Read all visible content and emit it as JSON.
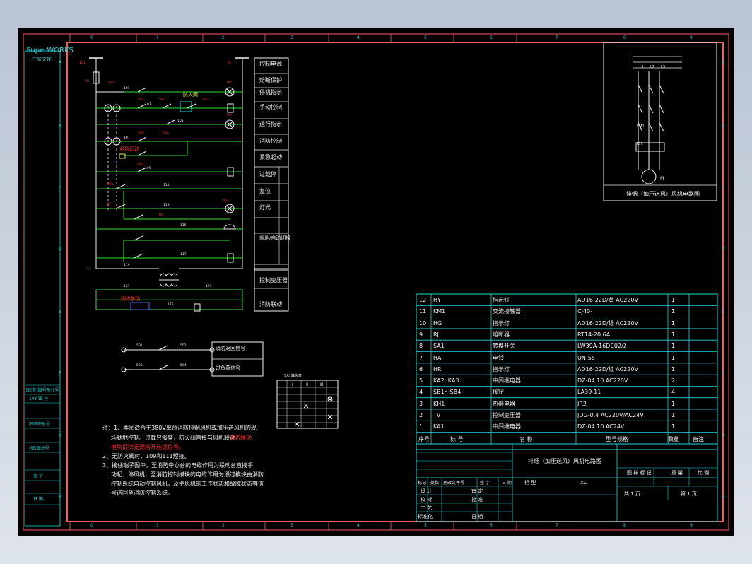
{
  "logo": {
    "brand": "SuperWORKS",
    "sub": "注册文件"
  },
  "ruler": {
    "top": [
      "0",
      "1",
      "2",
      "3",
      "4",
      "5",
      "6",
      "7",
      "8",
      "9"
    ],
    "left": [
      "A",
      "B",
      "C",
      "D",
      "E",
      "F",
      "G",
      "H"
    ]
  },
  "left_strip": [
    "图(参)图号及代号",
    "10Y 图 号",
    "旧底图总号",
    "(底)图总号",
    "签 字",
    "日 期"
  ],
  "schematic": {
    "panel_labels": [
      "控制电源",
      "熔断保护",
      "停机指示",
      "手动控制",
      "运行指示",
      "消防控制",
      "紧急起动",
      "过载停",
      "复位",
      "灯光",
      "就地/自动切换",
      "控制变压器",
      "消防联动"
    ],
    "fire_valve": "防火阀",
    "emergency_start": "紧急起动",
    "link_label": "消防联动",
    "top_node_left": "1L1",
    "top_node_right": "N",
    "wire_numbers": [
      "101",
      "103",
      "105",
      "107",
      "109",
      "111",
      "113",
      "115",
      "117",
      "119",
      "121",
      "173",
      "175",
      "177"
    ],
    "component_tags": [
      "FU",
      "SA1",
      "HR",
      "KA2",
      "HG",
      "SB1",
      "SB2",
      "SB3",
      "SB4",
      "KA1",
      "KH1",
      "TV",
      "HY",
      "KA3"
    ],
    "signal_labels": [
      "消防返回信号",
      "过负荷信号"
    ],
    "signal_wires": [
      "501",
      "502",
      "503",
      "504"
    ]
  },
  "motor_diagram": {
    "caption": "排烟（加压送风）风机电路图",
    "phases": [
      "L1",
      "L2",
      "L3"
    ],
    "km": "KM1",
    "kh": "KH",
    "motor": "M"
  },
  "switch_table": {
    "title": "SA1触头表",
    "headers": [
      "Ⅰ",
      "Ⅱ",
      "Ⅲ"
    ]
  },
  "notes": {
    "line1a": "注：1、本图适合于380V单台消防排烟风机或加压送风机的现",
    "line1b": "场就地控制。过载只报警，防火阀直接与风机联动，",
    "line1c_red": "消防联动",
    "line1d": "模块提供无源常开连锁信号。",
    "line2": "2、无防火阀时，109和111短接。",
    "line3a": "3、接线端子图中，至消防中心台的电缆作用为联动台直接手",
    "line3b": "动起、停风机，至消防控制模块的电缆作用为通过模块由消防",
    "line3c": "控制系统自动控制风机，及把风机的工作状态和故障状态等信",
    "line3d": "号送回至消防控制系统。"
  },
  "bom": {
    "rows": [
      {
        "no": "12",
        "code": "HY",
        "name": "指示灯",
        "spec": "AD16-22D/黄 AC220V",
        "qty": "1",
        "note": ""
      },
      {
        "no": "11",
        "code": "KM1",
        "name": "交流接触器",
        "spec": "CJ40-",
        "qty": "1",
        "note": ""
      },
      {
        "no": "10",
        "code": "HG",
        "name": "指示灯",
        "spec": "AD16-22D/绿 AC220V",
        "qty": "1",
        "note": ""
      },
      {
        "no": "9",
        "code": "RJ",
        "name": "熔断器",
        "spec": "RT14-20 6A",
        "qty": "1",
        "note": ""
      },
      {
        "no": "8",
        "code": "SA1",
        "name": "转换开关",
        "spec": "LW39A-16DC02/2",
        "qty": "1",
        "note": ""
      },
      {
        "no": "7",
        "code": "HA",
        "name": "电铃",
        "spec": "UN-55",
        "qty": "1",
        "note": ""
      },
      {
        "no": "6",
        "code": "HR",
        "name": "指示灯",
        "spec": "AD16-22D/红 AC220V",
        "qty": "1",
        "note": ""
      },
      {
        "no": "5",
        "code": "KA2, KA3",
        "name": "中间继电器",
        "spec": "DZ-04 10 AC220V",
        "qty": "2",
        "note": ""
      },
      {
        "no": "4",
        "code": "SB1～SB4",
        "name": "按钮",
        "spec": "LA39-11",
        "qty": "4",
        "note": ""
      },
      {
        "no": "3",
        "code": "KH1",
        "name": "热继电器",
        "spec": "JR2",
        "qty": "1",
        "note": ""
      },
      {
        "no": "2",
        "code": "TV",
        "name": "控制变压器",
        "spec": "JDG-0.4 AC220V/AC24V",
        "qty": "1",
        "note": ""
      },
      {
        "no": "1",
        "code": "KA1",
        "name": "中间继电器",
        "spec": "DZ-04 10 AC24V",
        "qty": "1",
        "note": ""
      }
    ],
    "headers": {
      "no": "序号",
      "code": "标 号",
      "name": "名 称",
      "spec": "型号规格",
      "qty": "数量",
      "note": "备注"
    }
  },
  "title_block": {
    "drawing_title": "排烟（加压送风）风机电路图",
    "type_label": "柜 型",
    "type_value": "XL",
    "stage": "图 样 标 记",
    "weight": "重 量",
    "scale": "比 例",
    "sheets": "共 1 页",
    "sheet": "第 1 页",
    "rev_labels": [
      "标记",
      "处数",
      "更改文件号",
      "签 字",
      "日 期"
    ],
    "roles": [
      "设 计",
      "校 对",
      "工 艺",
      "标准化"
    ],
    "approvals": [
      "审 定",
      "批 准",
      "",
      "日 期"
    ]
  },
  "colors": {
    "frame": "#ff5a5a",
    "cyan": "#20d8d8",
    "green": "#30e030",
    "white": "#f2f2f2",
    "red": "#ff3030",
    "yellow": "#e6e640",
    "blue": "#4a6aff"
  }
}
